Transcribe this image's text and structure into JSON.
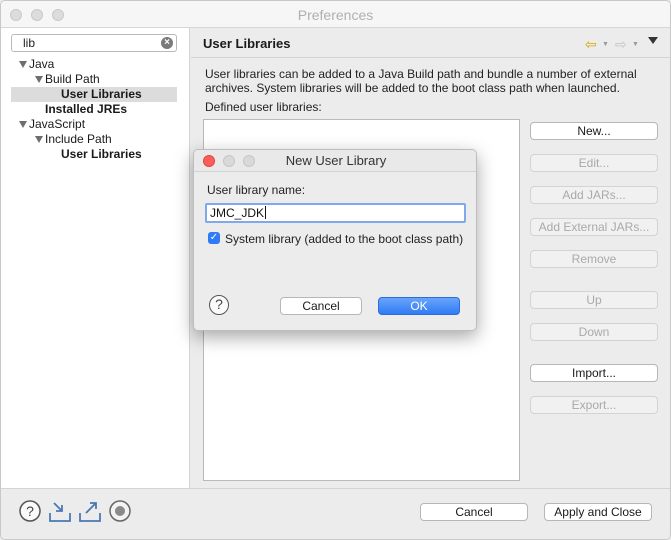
{
  "window": {
    "title": "Preferences"
  },
  "search": {
    "value": "lib"
  },
  "tree": {
    "java": "Java",
    "build_path": "Build Path",
    "user_libraries": "User Libraries",
    "installed_jres": "Installed JREs",
    "javascript": "JavaScript",
    "include_path": "Include Path",
    "js_user_libraries": "User Libraries"
  },
  "page": {
    "title": "User Libraries",
    "description_line1": "User libraries can be added to a Java Build path and bundle a number of external",
    "description_line2": "archives. System libraries will be added to the boot class path when launched.",
    "defined_label": "Defined user libraries:"
  },
  "buttons": {
    "new": "New...",
    "edit": "Edit...",
    "add_jars": "Add JARs...",
    "add_external_jars": "Add External JARs...",
    "remove": "Remove",
    "up": "Up",
    "down": "Down",
    "import": "Import...",
    "export": "Export..."
  },
  "footer": {
    "cancel": "Cancel",
    "apply_close": "Apply and Close"
  },
  "dialog": {
    "title": "New User Library",
    "name_label": "User library name:",
    "name_value": "JMC_JDK",
    "system_checkbox_label": "System library (added to the boot class path)",
    "system_checked": true,
    "cancel": "Cancel",
    "ok": "OK"
  },
  "colors": {
    "accent": "#2f7bf5",
    "back_arrow": "#d9a600"
  }
}
